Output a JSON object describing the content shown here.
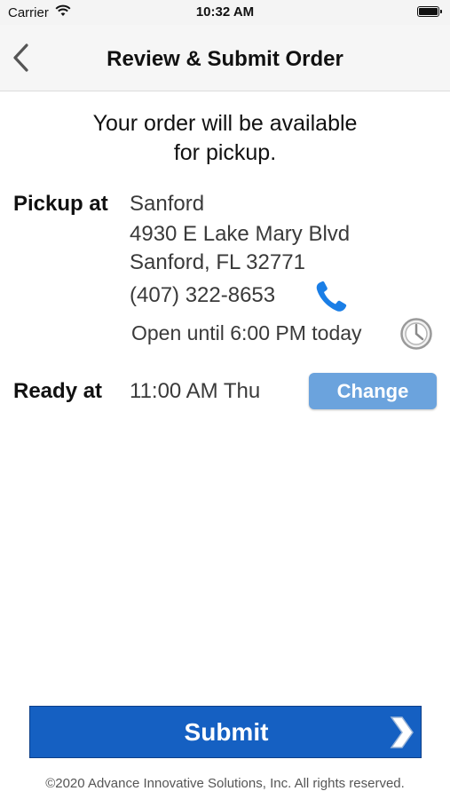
{
  "status_bar": {
    "carrier": "Carrier",
    "time": "10:32 AM"
  },
  "nav": {
    "title": "Review & Submit Order",
    "back_icon": "chevron-left-icon"
  },
  "intro": {
    "line1": "Your order will be available",
    "line2": "for pickup."
  },
  "pickup": {
    "label": "Pickup at",
    "store": "Sanford",
    "address_line1": "4930 E Lake Mary Blvd",
    "address_line2": "Sanford, FL 32771",
    "phone": "(407) 322-8653",
    "hours": "Open until 6:00 PM today"
  },
  "ready": {
    "label": "Ready at",
    "time": "11:00 AM Thu",
    "change_label": "Change"
  },
  "submit": {
    "label": "Submit"
  },
  "footer": {
    "copyright": "©2020 Advance Innovative Solutions, Inc. All rights reserved."
  },
  "colors": {
    "accent": "#1560c2",
    "change_button": "#6ba3dd",
    "phone_icon": "#1a7ee6"
  }
}
